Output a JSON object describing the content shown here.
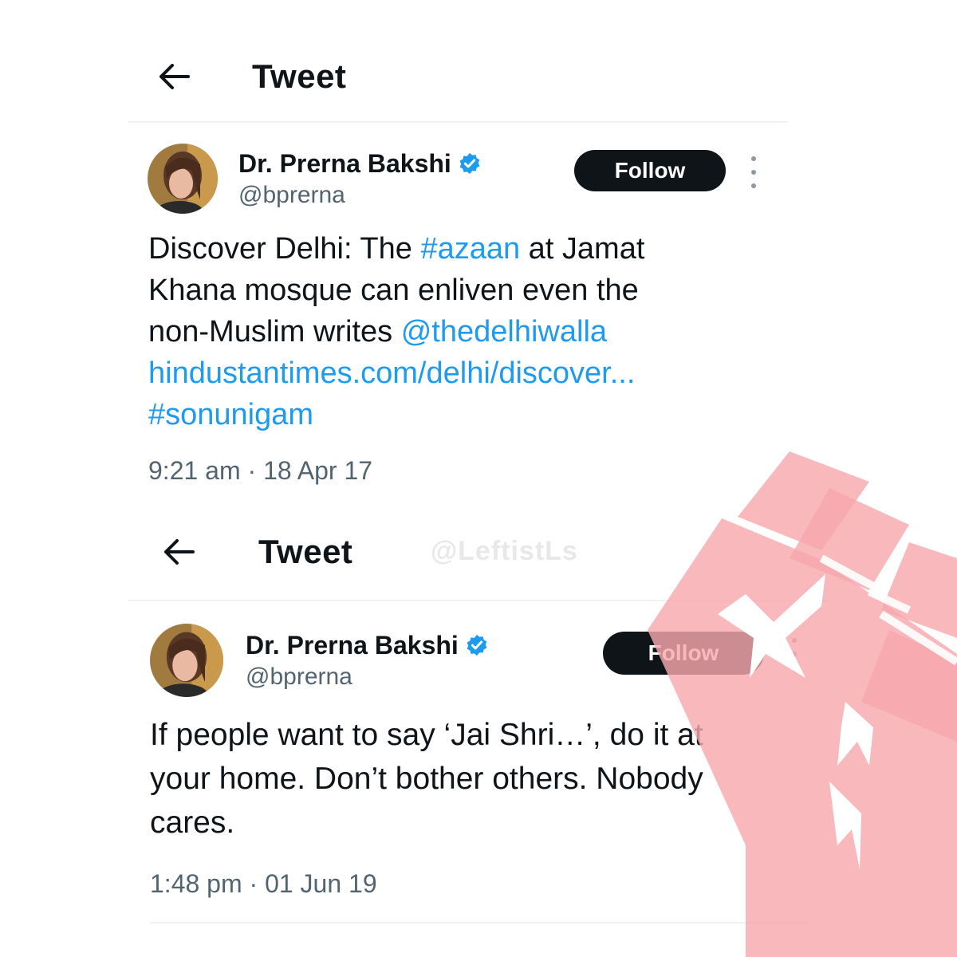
{
  "tweets": [
    {
      "header_title": "Tweet",
      "author_name": "Dr. Prerna Bakshi",
      "author_handle": "@bprerna",
      "follow_label": "Follow",
      "body": {
        "l1_a": "Discover Delhi: The ",
        "l1_tag": "#azaan",
        "l1_b": " at Jamat",
        "l2": "Khana mosque can enliven even the",
        "l3_a": "non-Muslim writes ",
        "l3_mention": "@thedelhiwalla",
        "l4_link": "hindustantimes.com/delhi/discover...",
        "l5_tag": "#sonunigam"
      },
      "timestamp": "9:21 am · 18 Apr 17"
    },
    {
      "header_title": "Tweet",
      "author_name": "Dr. Prerna Bakshi",
      "author_handle": "@bprerna",
      "follow_label": "Follow",
      "body": {
        "l1": "If people want to say ‘Jai Shri…’, do it at",
        "l2": "your home. Don’t bother others. Nobody",
        "l3": "cares."
      },
      "timestamp": "1:48 pm · 01 Jun 19"
    }
  ],
  "watermark": "@LeftistLs",
  "colors": {
    "link": "#1d9bf0",
    "verified": "#1d9bf0",
    "follow_bg": "#0f1419",
    "fist": "#f7a8ad"
  },
  "icons": [
    "back-arrow-icon",
    "verified-badge-icon",
    "more-options-icon",
    "raised-fist-icon"
  ]
}
